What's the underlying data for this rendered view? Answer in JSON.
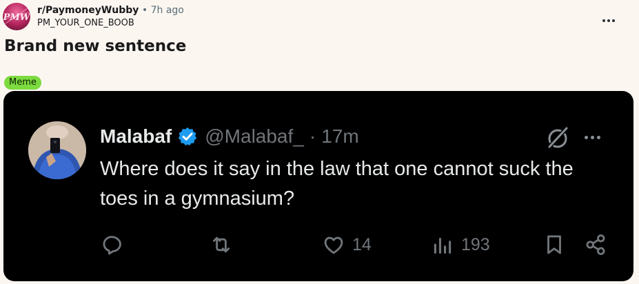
{
  "post": {
    "subreddit": "r/PaymoneyWubby",
    "separator": "•",
    "time": "7h ago",
    "username": "PM_YOUR_ONE_BOOB",
    "title": "Brand new sentence",
    "flair": "Meme",
    "avatar_text": "PMW",
    "flair_color": "#7cdb3f"
  },
  "tweet": {
    "name": "Malabaf",
    "handle": "@Malabaf_",
    "separator": "·",
    "time": "17m",
    "text": "Where does it say in the law that one cannot suck the toes in a gymnasium?",
    "verified_color": "#1d9bf0",
    "actions": {
      "reply_count": "",
      "retweet_count": "",
      "like_count": "14",
      "views_count": "193"
    },
    "icons": [
      "grok-icon",
      "reply-icon",
      "retweet-icon",
      "like-icon",
      "views-icon",
      "bookmark-icon",
      "share-icon"
    ]
  }
}
